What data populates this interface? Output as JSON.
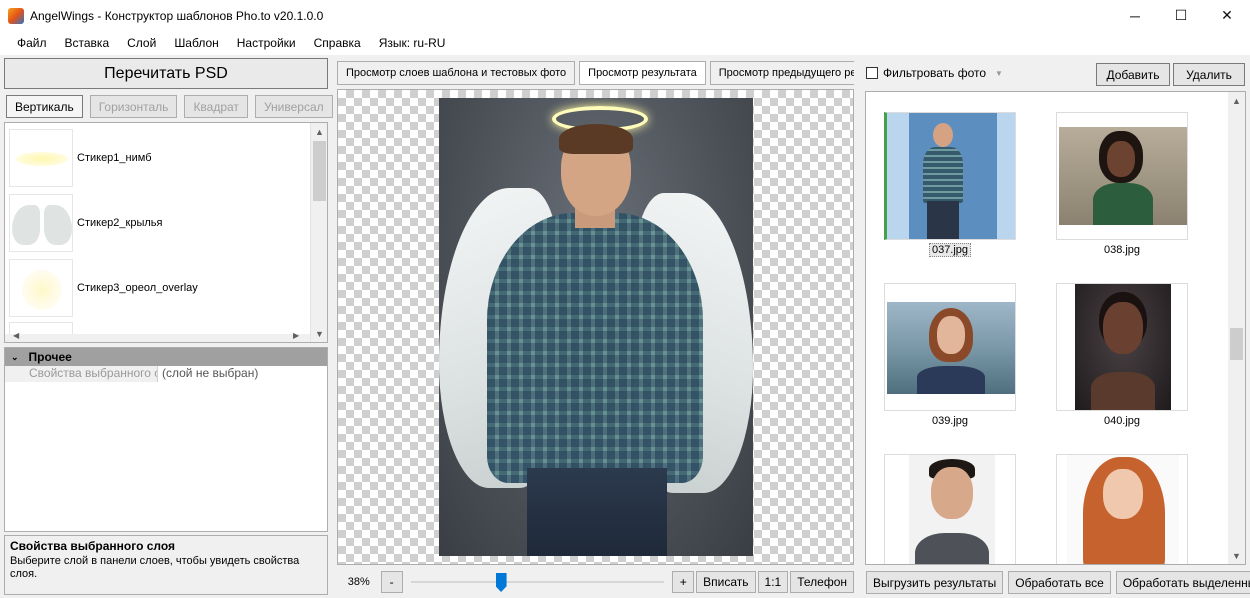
{
  "window": {
    "title": "AngelWings - Конструктор шаблонов Pho.to v20.1.0.0",
    "minimize": "─",
    "maximize": "☐",
    "close": "✕"
  },
  "menu": [
    "Файл",
    "Вставка",
    "Слой",
    "Шаблон",
    "Настройки",
    "Справка",
    "Язык: ru-RU"
  ],
  "left": {
    "reread_label": "Перечитать PSD",
    "orientations": [
      {
        "label": "Вертикаль",
        "active": true
      },
      {
        "label": "Горизонталь",
        "active": false
      },
      {
        "label": "Квадрат",
        "active": false
      },
      {
        "label": "Универсал",
        "active": false
      }
    ],
    "layers": [
      "Стикер1_нимб",
      "Стикер2_крылья",
      "Стикер3_ореол_overlay"
    ],
    "props": {
      "category": "Прочее",
      "row_label": "Свойства выбранного слоя",
      "row_value": "(слой не выбран)"
    },
    "help": {
      "title": "Свойства выбранного слоя",
      "text": "Выберите слой в панели слоев, чтобы увидеть свойства слоя."
    }
  },
  "center": {
    "tabs": [
      {
        "label": "Просмотр слоев шаблона и тестовых фото",
        "active": false
      },
      {
        "label": "Просмотр результата",
        "active": true
      },
      {
        "label": "Просмотр предыдущего ре",
        "active": false
      }
    ],
    "zoom": {
      "level": "38%",
      "minus": "-",
      "plus": "+",
      "fit": "Вписать",
      "one_to_one": "1:1",
      "phone": "Телефон",
      "slider_position": 0.35
    }
  },
  "right": {
    "filter_label": "Фильтровать фото",
    "add_label": "Добавить",
    "delete_label": "Удалить",
    "photos": [
      {
        "name": "037.jpg",
        "selected": true
      },
      {
        "name": "038.jpg",
        "selected": false
      },
      {
        "name": "039.jpg",
        "selected": false
      },
      {
        "name": "040.jpg",
        "selected": false
      },
      {
        "name": "",
        "selected": false
      },
      {
        "name": "",
        "selected": false
      }
    ],
    "actions": [
      "Выгрузить результаты",
      "Обработать все",
      "Обработать выделенные"
    ]
  },
  "colors": {
    "accent": "#0078d7",
    "selection": "#46a049"
  }
}
